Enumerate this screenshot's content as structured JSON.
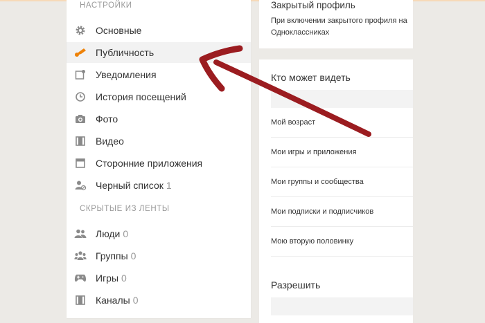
{
  "sidebar": {
    "section_settings": "НАСТРОЙКИ",
    "items": [
      {
        "label": "Основные",
        "icon": "gear-icon"
      },
      {
        "label": "Публичность",
        "icon": "public-icon"
      },
      {
        "label": "Уведомления",
        "icon": "notification-icon"
      },
      {
        "label": "История посещений",
        "icon": "history-icon"
      },
      {
        "label": "Фото",
        "icon": "camera-icon"
      },
      {
        "label": "Видео",
        "icon": "film-icon"
      },
      {
        "label": "Сторонние приложения",
        "icon": "window-icon"
      },
      {
        "label": "Черный список",
        "count": "1",
        "icon": "blocked-user-icon"
      }
    ],
    "section_hidden": "СКРЫТЫЕ ИЗ ЛЕНТЫ",
    "hidden_items": [
      {
        "label": "Люди",
        "count": "0",
        "icon": "people-icon"
      },
      {
        "label": "Группы",
        "count": "0",
        "icon": "groups-icon"
      },
      {
        "label": "Игры",
        "count": "0",
        "icon": "gamepad-icon"
      },
      {
        "label": "Каналы",
        "count": "0",
        "icon": "channel-icon"
      }
    ]
  },
  "closed_profile": {
    "title": "Закрытый профиль",
    "description": "При включении закрытого профиля на Одноклассниках"
  },
  "visibility": {
    "title": "Кто может видеть",
    "rows": [
      "Мой возраст",
      "Мои игры и приложения",
      "Мои группы и сообщества",
      "Мои подписки и подписчиков",
      "Мою вторую половинку"
    ],
    "allow_title": "Разрешить"
  },
  "colors": {
    "accent": "#ee8208",
    "annotation_arrow": "#9b1c20"
  }
}
